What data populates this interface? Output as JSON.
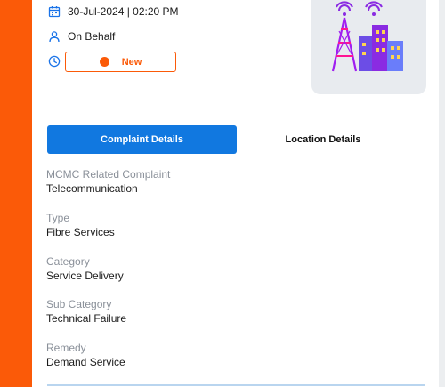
{
  "header": {
    "datetime": "30-Jul-2024 | 02:20 PM",
    "on_behalf": "On Behalf",
    "status": "New"
  },
  "tabs": [
    {
      "label": "Complaint Details",
      "active": true
    },
    {
      "label": "Location Details",
      "active": false
    }
  ],
  "fields": [
    {
      "label": "MCMC Related Complaint",
      "value": "Telecommunication"
    },
    {
      "label": "Type",
      "value": "Fibre Services"
    },
    {
      "label": "Category",
      "value": "Service Delivery"
    },
    {
      "label": "Sub Category",
      "value": "Technical Failure"
    },
    {
      "label": "Remedy",
      "value": "Demand Service"
    }
  ],
  "colors": {
    "accent_orange": "#fb5a08",
    "primary_blue": "#1178e0",
    "icon_blue": "#1a73e8"
  },
  "icons": {
    "date": "calendar-icon",
    "behalf": "person-icon",
    "status": "clock-icon",
    "illustration": "telecom-tower-buildings-illustration"
  }
}
